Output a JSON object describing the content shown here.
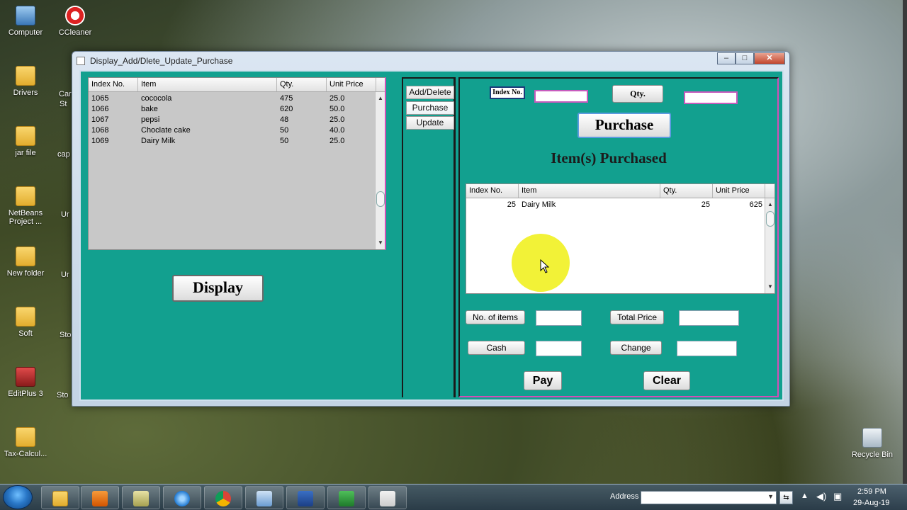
{
  "desktop": {
    "icons": [
      {
        "label": "Computer"
      },
      {
        "label": "CCleaner"
      },
      {
        "label": "Drivers"
      },
      {
        "label": "jar file"
      },
      {
        "label": "NetBeans Project ..."
      },
      {
        "label": "New folder"
      },
      {
        "label": "Soft"
      },
      {
        "label": "EditPlus 3"
      },
      {
        "label": "Tax-Calcul..."
      },
      {
        "label": "Recycle Bin"
      }
    ],
    "partial_labels": [
      "Car",
      "St",
      "cap",
      "Ur",
      "Ur",
      "Sto",
      "Sto"
    ]
  },
  "window": {
    "title": "Display_Add/Dlete_Update_Purchase",
    "controls": {
      "minimize": "–",
      "maximize": "□",
      "close": "✕"
    }
  },
  "left_table": {
    "headers": [
      "Index No.",
      "Item",
      "Qty.",
      "Unit Price"
    ],
    "rows": [
      [
        "1065",
        "cococola",
        "475",
        "25.0"
      ],
      [
        "1066",
        "bake",
        "620",
        "50.0"
      ],
      [
        "1067",
        "pepsi",
        "48",
        "25.0"
      ],
      [
        "1068",
        "Choclate cake",
        "50",
        "40.0"
      ],
      [
        "1069",
        "Dairy Milk",
        "50",
        "25.0"
      ]
    ]
  },
  "display_button": "Display",
  "tabs": [
    "Add/Delete",
    "Purchase",
    "Update"
  ],
  "selected_tab": "Purchase",
  "purchase": {
    "index_label": "Index No.",
    "qty_button": "Qty.",
    "purchase_button": "Purchase",
    "heading": "Item(s) Purchased",
    "table": {
      "headers": [
        "Index No.",
        "Item",
        "Qty.",
        "Unit Price"
      ],
      "rows": [
        [
          "25",
          "Dairy Milk",
          "25",
          "625"
        ]
      ]
    },
    "no_items_button": "No. of items",
    "total_price_button": "Total Price",
    "cash_button": "Cash",
    "change_button": "Change",
    "pay_button": "Pay",
    "clear_button": "Clear"
  },
  "taskbar": {
    "address_label": "Address",
    "time": "2:59 PM",
    "date": "29-Aug-19"
  },
  "colors": {
    "panel": "#12a08f",
    "highlight_border": "#d34fb8"
  }
}
